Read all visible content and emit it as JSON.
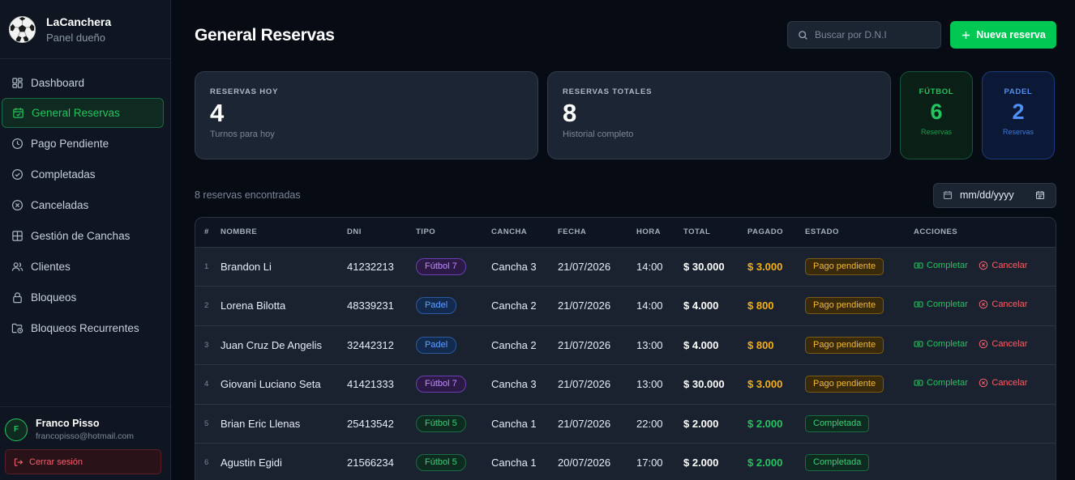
{
  "brand": {
    "name": "LaCanchera",
    "subtitle": "Panel dueño"
  },
  "sidebar": {
    "items": [
      {
        "label": "Dashboard",
        "icon": "dashboard-icon"
      },
      {
        "label": "General Reservas",
        "icon": "calendar-check-icon",
        "active": true
      },
      {
        "label": "Pago Pendiente",
        "icon": "clock-icon"
      },
      {
        "label": "Completadas",
        "icon": "check-circle-icon"
      },
      {
        "label": "Canceladas",
        "icon": "x-circle-icon"
      },
      {
        "label": "Gestión de Canchas",
        "icon": "grid-icon"
      },
      {
        "label": "Clientes",
        "icon": "users-icon"
      },
      {
        "label": "Bloqueos",
        "icon": "lock-icon"
      },
      {
        "label": "Bloqueos Recurrentes",
        "icon": "folder-clock-icon"
      }
    ]
  },
  "user": {
    "initial": "F",
    "name": "Franco Pisso",
    "email": "francopisso@hotmail.com",
    "logout_label": "Cerrar sesión"
  },
  "header": {
    "title": "General Reservas",
    "search_placeholder": "Buscar por D.N.I",
    "new_button": "Nueva reserva"
  },
  "stats": {
    "today": {
      "label": "RESERVAS HOY",
      "value": "4",
      "sub": "Turnos para hoy"
    },
    "total": {
      "label": "RESERVAS TOTALES",
      "value": "8",
      "sub": "Historial completo"
    },
    "futbol": {
      "label": "FÚTBOL",
      "value": "6",
      "sub": "Reservas"
    },
    "padel": {
      "label": "PADEL",
      "value": "2",
      "sub": "Reservas"
    }
  },
  "filter": {
    "found": "8 reservas encontradas",
    "date_placeholder": "mm/dd/yyyy"
  },
  "table": {
    "headers": [
      "#",
      "NOMBRE",
      "DNI",
      "TIPO",
      "CANCHA",
      "FECHA",
      "HORA",
      "TOTAL",
      "PAGADO",
      "ESTADO",
      "ACCIONES"
    ],
    "actions": {
      "complete": "Completar",
      "cancel": "Cancelar"
    },
    "rows": [
      {
        "n": "1",
        "nombre": "Brandon Li",
        "dni": "41232213",
        "tipo": "Fútbol 7",
        "cancha": "Cancha 3",
        "fecha": "21/07/2026",
        "hora": "14:00",
        "total": "$ 30.000",
        "pagado": "$ 3.000",
        "estado": "Pago pendiente"
      },
      {
        "n": "2",
        "nombre": "Lorena Bilotta",
        "dni": "48339231",
        "tipo": "Padel",
        "cancha": "Cancha 2",
        "fecha": "21/07/2026",
        "hora": "14:00",
        "total": "$ 4.000",
        "pagado": "$ 800",
        "estado": "Pago pendiente"
      },
      {
        "n": "3",
        "nombre": "Juan Cruz De Angelis",
        "dni": "32442312",
        "tipo": "Padel",
        "cancha": "Cancha 2",
        "fecha": "21/07/2026",
        "hora": "13:00",
        "total": "$ 4.000",
        "pagado": "$ 800",
        "estado": "Pago pendiente"
      },
      {
        "n": "4",
        "nombre": "Giovani Luciano Seta",
        "dni": "41421333",
        "tipo": "Fútbol 7",
        "cancha": "Cancha 3",
        "fecha": "21/07/2026",
        "hora": "13:00",
        "total": "$ 30.000",
        "pagado": "$ 3.000",
        "estado": "Pago pendiente"
      },
      {
        "n": "5",
        "nombre": "Brian Eric Llenas",
        "dni": "25413542",
        "tipo": "Fútbol 5",
        "cancha": "Cancha 1",
        "fecha": "21/07/2026",
        "hora": "22:00",
        "total": "$ 2.000",
        "pagado": "$ 2.000",
        "estado": "Completada"
      },
      {
        "n": "6",
        "nombre": "Agustin Egidi",
        "dni": "21566234",
        "tipo": "Fútbol 5",
        "cancha": "Cancha 1",
        "fecha": "20/07/2026",
        "hora": "17:00",
        "total": "$ 2.000",
        "pagado": "$ 2.000",
        "estado": "Completada"
      }
    ]
  },
  "colors": {
    "accent": "#00c853",
    "pending": "#f5b014",
    "danger": "#f4606d",
    "padel": "#4f8ff7",
    "futbol7": "#c08bff"
  }
}
